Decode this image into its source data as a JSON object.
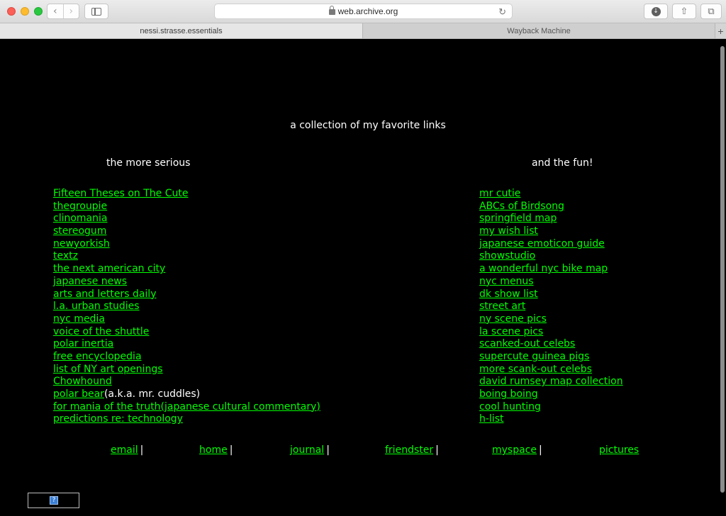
{
  "browser": {
    "url": "web.archive.org",
    "tabs": [
      {
        "label": "nessi.strasse.essentials"
      },
      {
        "label": "Wayback Machine"
      }
    ],
    "new_tab_glyph": "+"
  },
  "page": {
    "heading": "a collection of my favorite links",
    "left_column_title": "the more serious",
    "right_column_title": "and the fun!",
    "left_links": [
      {
        "text": "Fifteen Theses on The Cute"
      },
      {
        "text": "thegroupie"
      },
      {
        "text": "clinomania"
      },
      {
        "text": "stereogum"
      },
      {
        "text": "newyorkish"
      },
      {
        "text": "textz"
      },
      {
        "text": "the next american city"
      },
      {
        "text": "japanese news"
      },
      {
        "text": "arts and letters daily"
      },
      {
        "text": "l.a. urban studies"
      },
      {
        "text": "nyc media"
      },
      {
        "text": "voice of the shuttle"
      },
      {
        "text": "polar inertia"
      },
      {
        "text": "free encyclopedia"
      },
      {
        "text": "list of NY art openings"
      },
      {
        "text": "Chowhound"
      },
      {
        "text": "polar bear",
        "suffix": "(a.k.a. mr. cuddles)"
      },
      {
        "text": "for mania of the truth(japanese cultural commentary)"
      },
      {
        "text": "predictions re: technology"
      }
    ],
    "right_links": [
      {
        "text": "mr cutie"
      },
      {
        "text": "ABCs of Birdsong"
      },
      {
        "text": "springfield map"
      },
      {
        "text": "my wish list"
      },
      {
        "text": "japanese emoticon guide"
      },
      {
        "text": "showstudio"
      },
      {
        "text": "a wonderful nyc bike map"
      },
      {
        "text": "nyc menus"
      },
      {
        "text": "dk show list"
      },
      {
        "text": "street art"
      },
      {
        "text": "ny scene pics"
      },
      {
        "text": "la scene pics"
      },
      {
        "text": "scanked-out celebs"
      },
      {
        "text": "supercute guinea pigs"
      },
      {
        "text": "more scank-out celebs"
      },
      {
        "text": "david rumsey map collection"
      },
      {
        "text": "boing boing"
      },
      {
        "text": "cool hunting"
      },
      {
        "text": "h-list"
      }
    ],
    "footer": [
      {
        "text": "email",
        "sep": "|"
      },
      {
        "text": "home",
        "sep": "|"
      },
      {
        "text": "journal",
        "sep": "|"
      },
      {
        "text": "friendster",
        "sep": "|"
      },
      {
        "text": "myspace",
        "sep": "|"
      },
      {
        "text": "pictures",
        "sep": ""
      }
    ],
    "badge_glyph": "?"
  },
  "colors": {
    "background": "#000000",
    "link": "#00ff00",
    "text": "#ffffff"
  }
}
